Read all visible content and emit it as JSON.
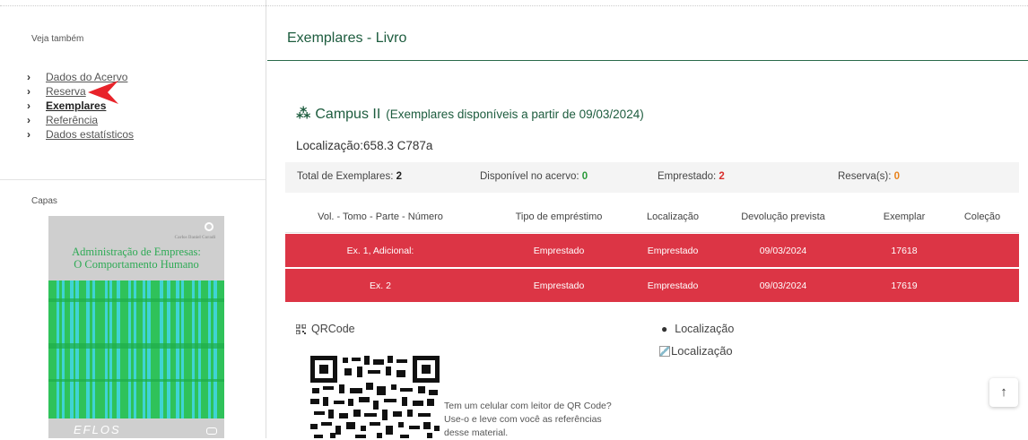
{
  "sidebar": {
    "see_also_title": "Veja também",
    "items": [
      {
        "label": "Dados do Acervo",
        "active": false
      },
      {
        "label": "Reserva",
        "active": false
      },
      {
        "label": "Exemplares",
        "active": true
      },
      {
        "label": "Referência",
        "active": false
      },
      {
        "label": "Dados estatísticos",
        "active": false
      }
    ],
    "covers_title": "Capas",
    "cover": {
      "author": "Carlos Daniel Coradi",
      "title_line1": "Administração de Empresas:",
      "title_line2": "O Comportamento Humano",
      "publisher": "EFLOS"
    },
    "arrow_color": "#e8232a"
  },
  "main": {
    "title": "Exemplares - Livro",
    "campus_icon": "campus-tree-icon",
    "campus_name": "Campus II",
    "campus_sub": "(Exemplares disponíveis a partir de 09/03/2024)",
    "location_line": "Localização:658.3 C787a",
    "totals": {
      "total_label": "Total de Exemplares: ",
      "total_value": "2",
      "available_label": "Disponível no acervo: ",
      "available_value": "0",
      "borrowed_label": "Emprestado: ",
      "borrowed_value": "2",
      "reserved_label": "Reserva(s): ",
      "reserved_value": "0"
    },
    "table": {
      "headers": [
        "Vol. - Tomo - Parte - Número",
        "Tipo de empréstimo",
        "Localização",
        "Devolução prevista",
        "Exemplar",
        "Coleção"
      ],
      "rows": [
        [
          "Ex. 1, Adicional:",
          "Emprestado",
          "Emprestado",
          "09/03/2024",
          "17618",
          ""
        ],
        [
          "Ex. 2",
          "Emprestado",
          "Emprestado",
          "09/03/2024",
          "17619",
          ""
        ]
      ]
    },
    "qrcode_label": "QRCode",
    "qr_text": [
      "Tem um celular com leitor de QR Code?",
      "Use-o e leve com você as referências",
      "desse material."
    ],
    "location_label": "Localização",
    "location_img_alt": "Localização",
    "back_to_top": "↑"
  },
  "colors": {
    "accent": "#1d5c3e",
    "row_red": "#dc3545",
    "available_green": "#2a9a3a",
    "borrowed_red": "#d9302f",
    "reserved_orange": "#e8821c"
  }
}
